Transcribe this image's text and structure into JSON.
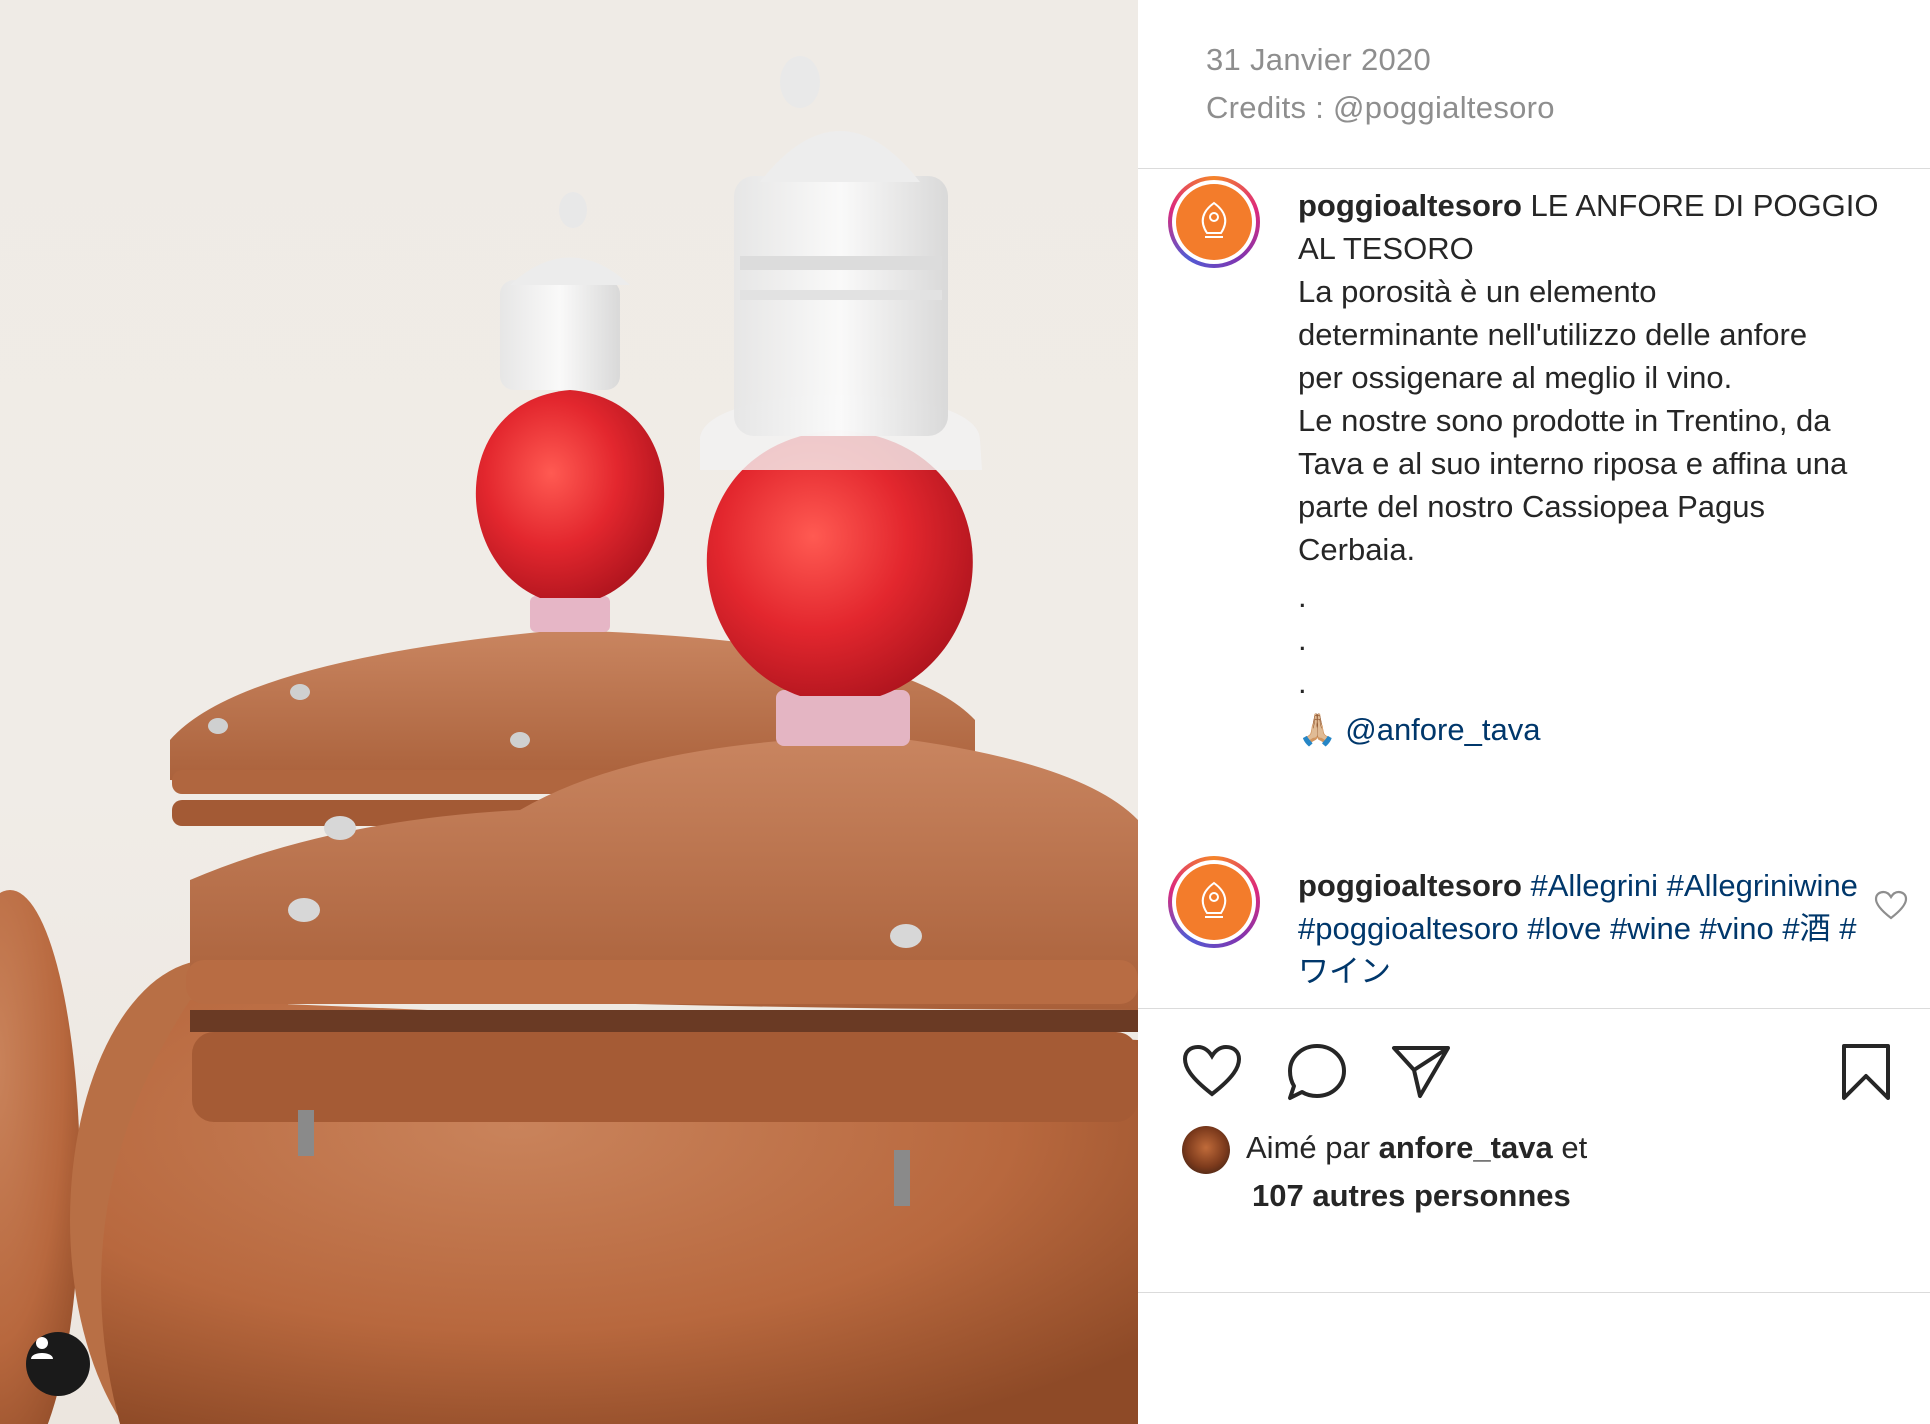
{
  "post": {
    "date": "31 Janvier 2020",
    "credits": "Credits : @poggialtesoro"
  },
  "caption": {
    "username": "poggioaltesoro",
    "title": "LE ANFORE DI POGGIO AL TESORO",
    "line1": "La porosità è un elemento",
    "line2": "determinante nell'utilizzo delle anfore",
    "line3": "per ossigenare al meglio il vino.",
    "line4": "Le nostre sono prodotte in Trentino, da",
    "line5": "Tava e al suo interno riposa e affina una",
    "line6": "parte del nostro Cassiopea Pagus",
    "line7": "Cerbaia.",
    "dot": ".",
    "emoji": "🙏🏼",
    "mention": "@anfore_tava"
  },
  "comment": {
    "username": "poggioaltesoro",
    "tag1": "#Allegrini",
    "tag2": "#Allegriniwine",
    "tag3": "#poggioaltesoro",
    "tag4": "#love",
    "tag5": "#wine",
    "tag6": "#vino",
    "tag7": "#酒",
    "tag8": "#ワイン"
  },
  "likes": {
    "prefix": "Aimé par",
    "user": "anfore_tava",
    "conj": "et",
    "others": "107 autres personnes"
  },
  "icons": {
    "like": "heart-icon",
    "comment": "comment-icon",
    "share": "paper-plane-icon",
    "save": "bookmark-icon",
    "tag": "person-icon",
    "comment_like": "small-heart-icon"
  },
  "colors": {
    "link": "#00376b",
    "meta": "#8e8e8e",
    "brand_orange": "#f37c2b"
  }
}
